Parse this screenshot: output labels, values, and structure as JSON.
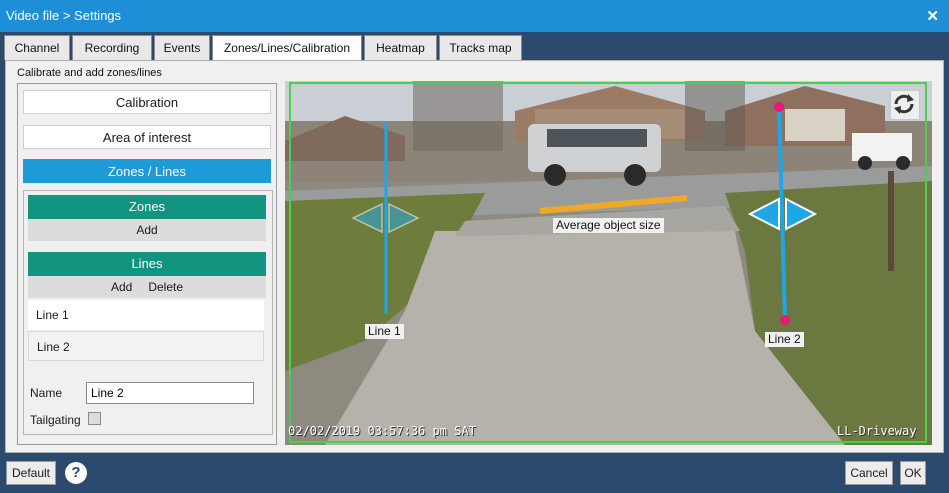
{
  "window": {
    "title": "Video file > Settings",
    "close_glyph": "✕"
  },
  "tabs": [
    {
      "label": "Channel",
      "active": false
    },
    {
      "label": "Recording",
      "active": false
    },
    {
      "label": "Events",
      "active": false
    },
    {
      "label": "Zones/Lines/Calibration",
      "active": true
    },
    {
      "label": "Heatmap",
      "active": false
    },
    {
      "label": "Tracks map",
      "active": false
    }
  ],
  "panel": {
    "caption": "Calibrate and add zones/lines"
  },
  "modes": [
    {
      "label": "Calibration",
      "active": false
    },
    {
      "label": "Area of interest",
      "active": false
    },
    {
      "label": "Zones / Lines",
      "active": true
    }
  ],
  "zones": {
    "header": "Zones",
    "add_label": "Add"
  },
  "lines": {
    "header": "Lines",
    "add_label": "Add",
    "delete_label": "Delete",
    "items": [
      {
        "label": "Line 1",
        "selected": false
      },
      {
        "label": "Line 2",
        "selected": true
      }
    ]
  },
  "properties": {
    "name_label": "Name",
    "name_value": "Line 2",
    "tailgating_label": "Tailgating",
    "tailgating_checked": false
  },
  "video": {
    "object_size_label": "Average object size",
    "line1_label": "Line 1",
    "line2_label": "Line 2",
    "timestamp": "02/02/2019 03:57:36 pm SAT",
    "camera_name": "LL-Driveway",
    "refresh_icon": "refresh-icon",
    "line_color": "#1ea6e6",
    "endpoint_color": "#e8197a",
    "object_size_color": "#f0a827",
    "aoi_border_color": "#4ccf4c"
  },
  "footer": {
    "default_label": "Default",
    "help_glyph": "?",
    "cancel_label": "Cancel",
    "ok_label": "OK"
  }
}
